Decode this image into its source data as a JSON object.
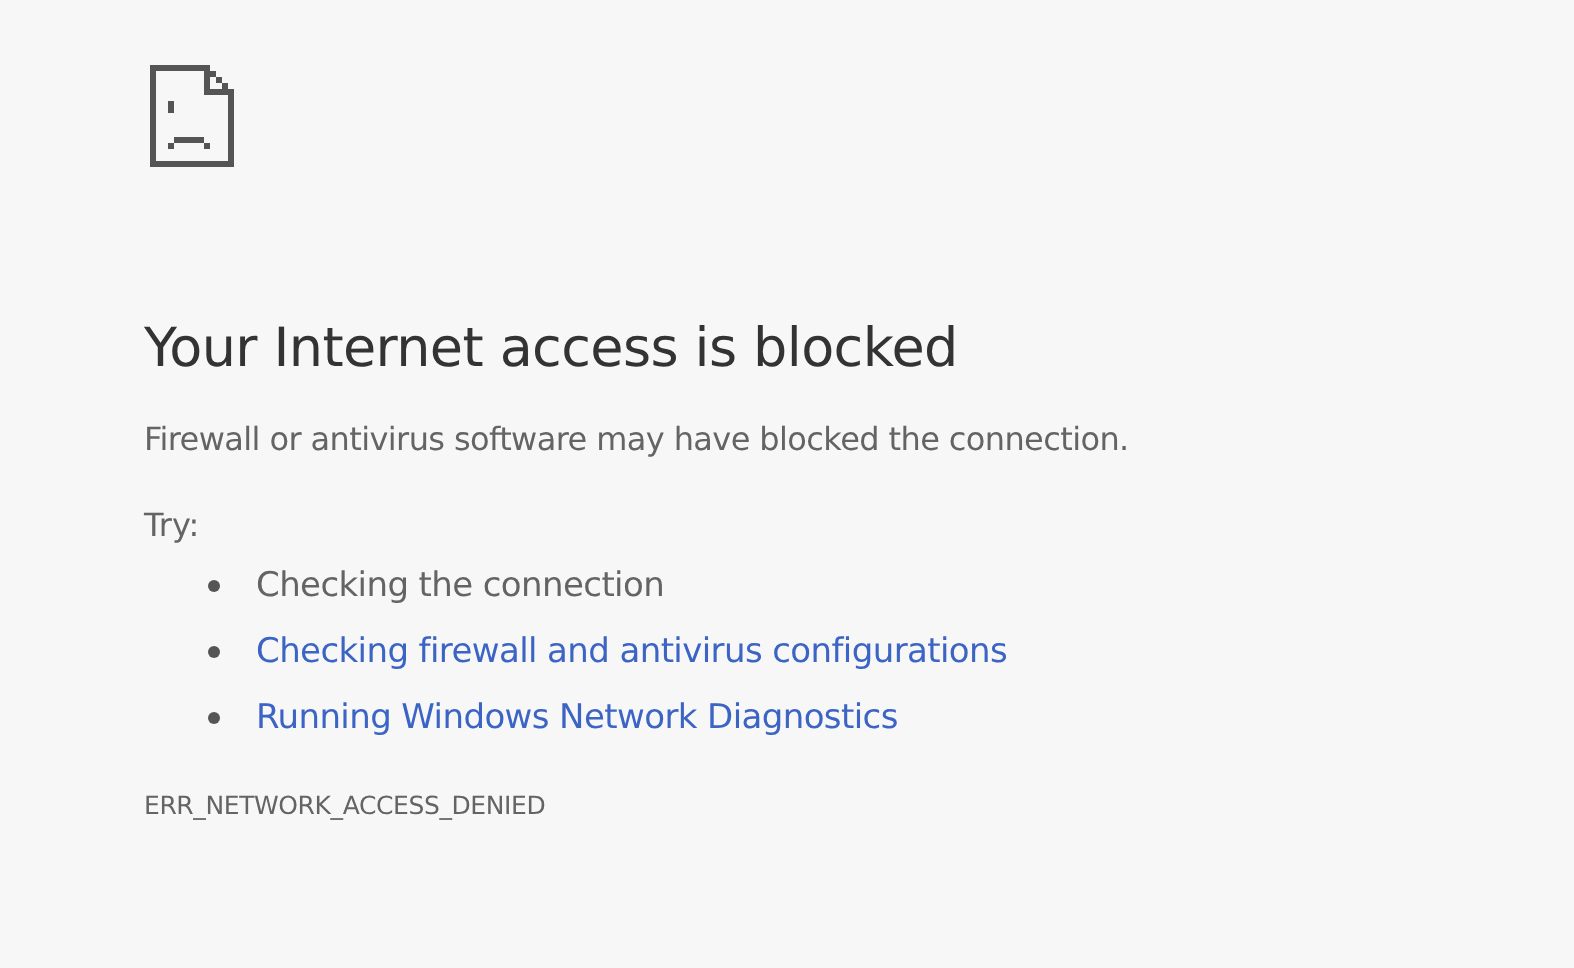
{
  "heading": "Your Internet access is blocked",
  "message": "Firewall or antivirus software may have blocked the connection.",
  "suggestions": {
    "label": "Try:",
    "items": [
      {
        "text": "Checking the connection",
        "kind": "text"
      },
      {
        "text": "Checking firewall and antivirus configurations",
        "kind": "link"
      },
      {
        "text": "Running Windows Network Diagnostics",
        "kind": "link"
      }
    ]
  },
  "error_code": "ERR_NETWORK_ACCESS_DENIED"
}
